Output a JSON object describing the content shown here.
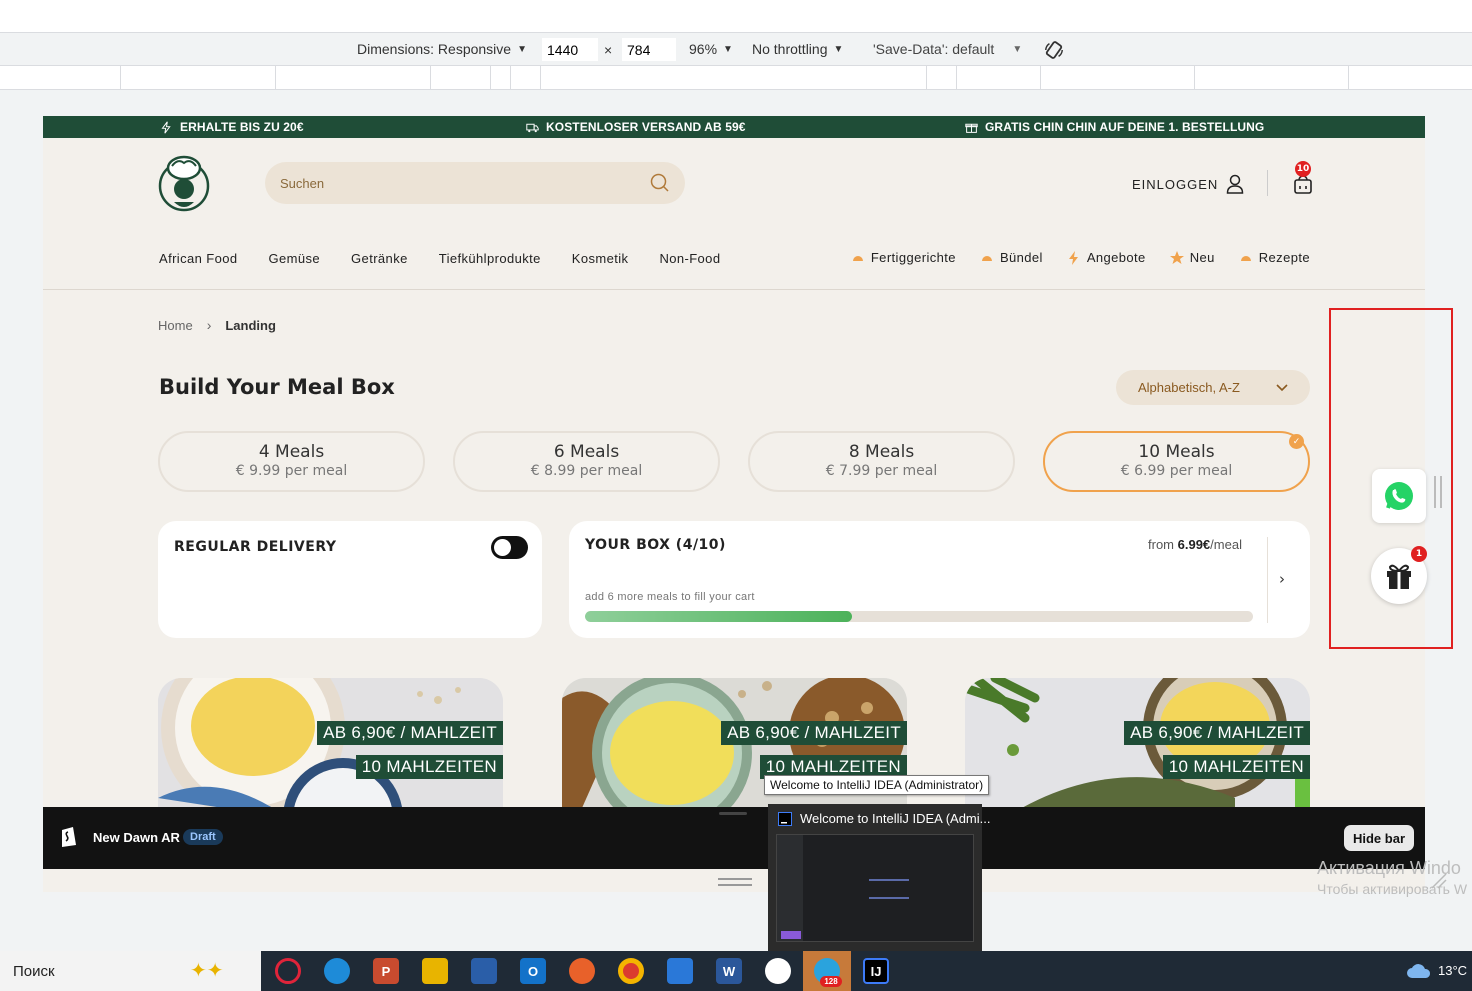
{
  "devtools": {
    "dimensions_label": "Dimensions: Responsive",
    "width": "1440",
    "height": "784",
    "times": "×",
    "zoom": "96%",
    "throttling": "No throttling",
    "save_data": "'Save-Data': default"
  },
  "promo": {
    "item1": "ERHALTE BIS ZU 20€",
    "item2": "KOSTENLOSER VERSAND AB 59€",
    "item3": "GRATIS CHIN CHIN AUF DEINE 1. BESTELLUNG"
  },
  "header": {
    "search_placeholder": "Suchen",
    "login": "EINLOGGEN",
    "cart_count": "10"
  },
  "nav": {
    "left": [
      "African Food",
      "Gemüse",
      "Getränke",
      "Tiefkühlprodukte",
      "Kosmetik",
      "Non-Food"
    ],
    "right": [
      "Fertiggerichte",
      "Bündel",
      "Angebote",
      "Neu",
      "Rezepte"
    ]
  },
  "breadcrumb": {
    "home": "Home",
    "current": "Landing"
  },
  "main": {
    "title": "Build Your Meal Box",
    "sort_label": "Alphabetisch, A-Z"
  },
  "plans": [
    {
      "name": "4 Meals",
      "price": "€ 9.99 per meal"
    },
    {
      "name": "6 Meals",
      "price": "€ 8.99 per meal"
    },
    {
      "name": "8 Meals",
      "price": "€ 7.99 per meal"
    },
    {
      "name": "10 Meals",
      "price": "€ 6.99 per meal",
      "selected": true
    }
  ],
  "delivery": {
    "title": "REGULAR DELIVERY",
    "enabled": true
  },
  "box": {
    "title": "YOUR BOX (4/10)",
    "from_label": "from",
    "from_price": "6.99€",
    "per_meal": "/meal",
    "hint": "add 6 more meals to fill your cart",
    "progress": 0.4
  },
  "meals": {
    "price_tag": "AB 6,90€ / MAHLZEIT",
    "count_tag": "10 MAHLZEITEN"
  },
  "shopify_bar": {
    "theme_name": "New Dawn AR",
    "status": "Draft",
    "hide_label": "Hide bar"
  },
  "floating": {
    "gift_count": "1"
  },
  "windows": {
    "activation_line1": "Активация Windo",
    "activation_line2": "Чтобы активировать W",
    "tooltip": "Welcome to IntelliJ IDEA (Administrator)",
    "preview_title": "Welcome to IntelliJ IDEA (Admi...",
    "search_label": "Поиск",
    "telegram_badge": "128",
    "temperature": "13°C"
  },
  "colors": {
    "brand_green": "#1f4d37",
    "accent_orange": "#f0a24c",
    "cream": "#f3f0eb",
    "highlight_red": "#e02020"
  }
}
